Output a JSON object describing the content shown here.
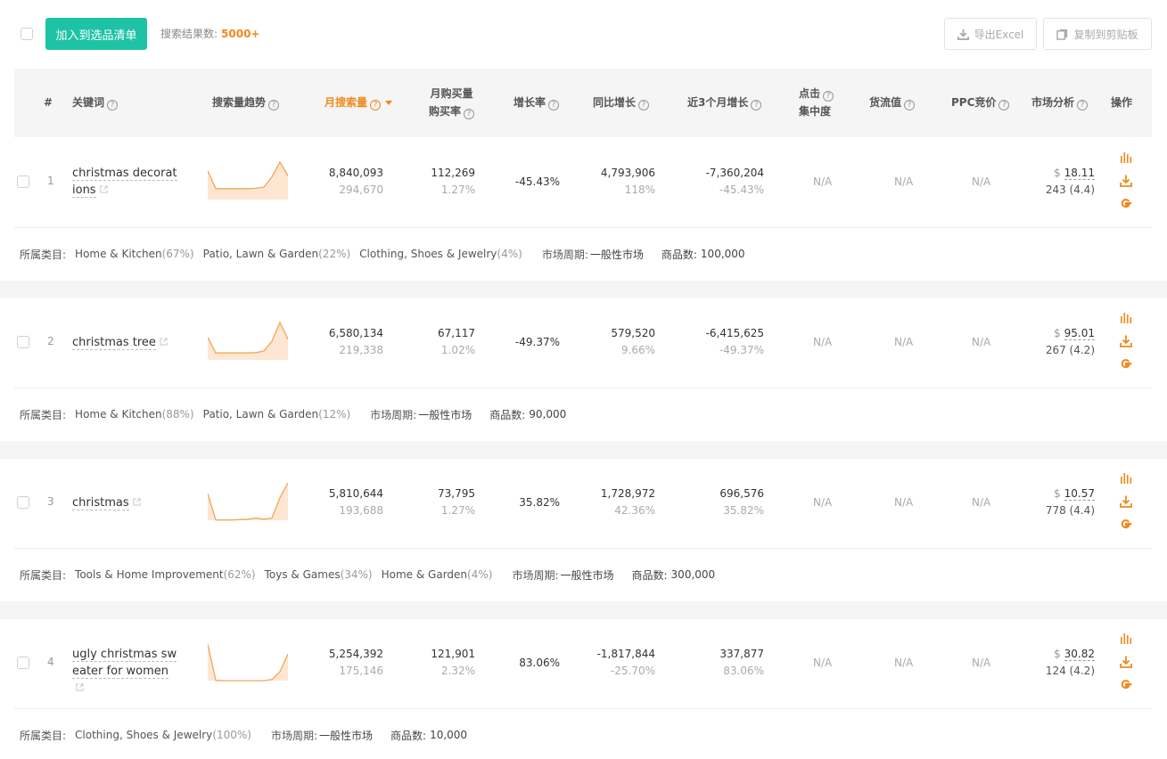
{
  "toolbar": {
    "add_label": "加入到选品清单",
    "result_label": "搜索结果数:",
    "result_count": "5000+",
    "export_label": "导出Excel",
    "copy_label": "复制到剪贴板"
  },
  "header": {
    "index": "#",
    "keyword": "关键词",
    "trend": "搜索量趋势",
    "monthly_search": "月搜索量",
    "monthly_purchase_l1": "月购买量",
    "monthly_purchase_l2": "购买率",
    "growth": "增长率",
    "yoy": "同比增长",
    "last3": "近3个月增长",
    "click_l1": "点击",
    "click_l2": "集中度",
    "goods_value": "货流值",
    "ppc": "PPC竞价",
    "market": "市场分析",
    "ops": "操作"
  },
  "category_label": "所属类目:",
  "cycle_label": "市场周期:",
  "goods_label": "商品数:",
  "rows": [
    {
      "index": "1",
      "keyword_l1": "christmas decorat",
      "keyword_l2": "ions",
      "search": "8,840,093",
      "search_sub": "294,670",
      "purchase": "112,269",
      "purchase_rate": "1.27%",
      "growth": "-45.43%",
      "yoy": "4,793,906",
      "yoy_sub": "118%",
      "last3": "-7,360,204",
      "last3_sub": "-45.43%",
      "click": "N/A",
      "goods_value": "N/A",
      "ppc": "N/A",
      "dollar": "$",
      "price": "18.11",
      "reviews": "243 (4.4)",
      "categories": [
        {
          "name": "Home & Kitchen",
          "pct": "(67%)"
        },
        {
          "name": "Patio, Lawn & Garden",
          "pct": "(22%)"
        },
        {
          "name": "Clothing, Shoes & Jewelry",
          "pct": "(4%)"
        }
      ],
      "cycle": "一般性市场",
      "goods": "100,000",
      "trend": [
        0.75,
        0.3,
        0.3,
        0.3,
        0.3,
        0.3,
        0.31,
        0.34,
        0.6,
        0.98,
        0.63
      ]
    },
    {
      "index": "2",
      "keyword_l1": "christmas tree",
      "keyword_l2": "",
      "search": "6,580,134",
      "search_sub": "219,338",
      "purchase": "67,117",
      "purchase_rate": "1.02%",
      "growth": "-49.37%",
      "yoy": "579,520",
      "yoy_sub": "9.66%",
      "last3": "-6,415,625",
      "last3_sub": "-49.37%",
      "click": "N/A",
      "goods_value": "N/A",
      "ppc": "N/A",
      "dollar": "$",
      "price": "95.01",
      "reviews": "267 (4.2)",
      "categories": [
        {
          "name": "Home & Kitchen",
          "pct": "(88%)"
        },
        {
          "name": "Patio, Lawn & Garden",
          "pct": "(12%)"
        }
      ],
      "cycle": "一般性市场",
      "goods": "90,000",
      "trend": [
        0.6,
        0.2,
        0.2,
        0.2,
        0.2,
        0.2,
        0.21,
        0.25,
        0.5,
        0.98,
        0.55
      ]
    },
    {
      "index": "3",
      "keyword_l1": "christmas",
      "keyword_l2": "",
      "search": "5,810,644",
      "search_sub": "193,688",
      "purchase": "73,795",
      "purchase_rate": "1.27%",
      "growth": "35.82%",
      "yoy": "1,728,972",
      "yoy_sub": "42.36%",
      "last3": "696,576",
      "last3_sub": "35.82%",
      "click": "N/A",
      "goods_value": "N/A",
      "ppc": "N/A",
      "dollar": "$",
      "price": "10.57",
      "reviews": "778 (4.4)",
      "categories": [
        {
          "name": "Tools & Home Improvement",
          "pct": "(62%)"
        },
        {
          "name": "Toys & Games",
          "pct": "(34%)"
        },
        {
          "name": "Home & Garden",
          "pct": "(4%)"
        }
      ],
      "cycle": "一般性市场",
      "goods": "300,000",
      "trend": [
        0.7,
        0.03,
        0.03,
        0.03,
        0.04,
        0.05,
        0.08,
        0.05,
        0.08,
        0.6,
        0.98
      ]
    },
    {
      "index": "4",
      "keyword_l1": "ugly christmas sw",
      "keyword_l2": "eater for women",
      "search": "5,254,392",
      "search_sub": "175,146",
      "purchase": "121,901",
      "purchase_rate": "2.32%",
      "growth": "83.06%",
      "yoy": "-1,817,844",
      "yoy_sub": "-25.70%",
      "last3": "337,877",
      "last3_sub": "83.06%",
      "click": "N/A",
      "goods_value": "N/A",
      "ppc": "N/A",
      "dollar": "$",
      "price": "30.82",
      "reviews": "124 (4.2)",
      "categories": [
        {
          "name": "Clothing, Shoes & Jewelry",
          "pct": "(100%)"
        }
      ],
      "cycle": "一般性市场",
      "goods": "10,000",
      "trend": [
        0.95,
        0.03,
        0.02,
        0.02,
        0.02,
        0.02,
        0.02,
        0.02,
        0.05,
        0.25,
        0.7
      ]
    }
  ],
  "colors": {
    "accent": "#f0891c",
    "primary_button": "#1ec3a5",
    "header_bg": "#f5f5f5"
  }
}
